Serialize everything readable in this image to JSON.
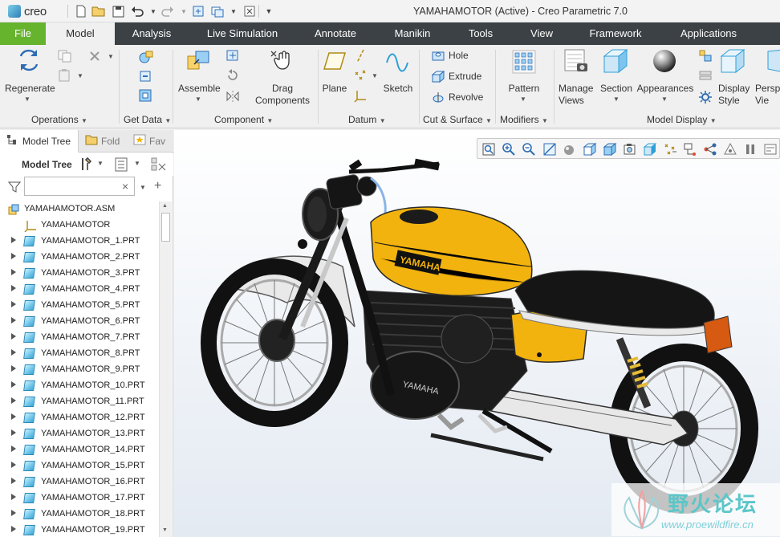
{
  "app": {
    "logo_text": "creo",
    "window_title": "YAMAHAMOTOR (Active) - Creo Parametric 7.0"
  },
  "tabs": [
    {
      "label": "File"
    },
    {
      "label": "Model"
    },
    {
      "label": "Analysis"
    },
    {
      "label": "Live Simulation"
    },
    {
      "label": "Annotate"
    },
    {
      "label": "Manikin"
    },
    {
      "label": "Tools"
    },
    {
      "label": "View"
    },
    {
      "label": "Framework"
    },
    {
      "label": "Applications"
    }
  ],
  "ribbon": {
    "regenerate": "Regenerate",
    "assemble": "Assemble",
    "drag_components": "Drag\nComponents",
    "plane": "Plane",
    "sketch": "Sketch",
    "hole": "Hole",
    "extrude": "Extrude",
    "revolve": "Revolve",
    "pattern": "Pattern",
    "manage_views": "Manage\nViews",
    "section": "Section",
    "appearances": "Appearances",
    "display_style": "Display\nStyle",
    "perspective": "Perspe\nVie",
    "groups": {
      "operations": "Operations",
      "get_data": "Get Data",
      "component": "Component",
      "datum": "Datum",
      "cut_surface": "Cut & Surface",
      "modifiers": "Modifiers",
      "model_display": "Model Display"
    }
  },
  "left_panel": {
    "tabs": [
      "Model Tree",
      "Fold",
      "Fav"
    ],
    "toolbar_label": "Model Tree",
    "search_value": "",
    "root": "YAMAHAMOTOR.ASM",
    "csys": "YAMAHAMOTOR",
    "parts": [
      "YAMAHAMOTOR_1.PRT",
      "YAMAHAMOTOR_2.PRT",
      "YAMAHAMOTOR_3.PRT",
      "YAMAHAMOTOR_4.PRT",
      "YAMAHAMOTOR_5.PRT",
      "YAMAHAMOTOR_6.PRT",
      "YAMAHAMOTOR_7.PRT",
      "YAMAHAMOTOR_8.PRT",
      "YAMAHAMOTOR_9.PRT",
      "YAMAHAMOTOR_10.PRT",
      "YAMAHAMOTOR_11.PRT",
      "YAMAHAMOTOR_12.PRT",
      "YAMAHAMOTOR_13.PRT",
      "YAMAHAMOTOR_14.PRT",
      "YAMAHAMOTOR_15.PRT",
      "YAMAHAMOTOR_16.PRT",
      "YAMAHAMOTOR_17.PRT",
      "YAMAHAMOTOR_18.PRT",
      "YAMAHAMOTOR_19.PRT"
    ]
  },
  "model": {
    "tank_brand": "YAMAHA",
    "engine_brand": "YAMAHA"
  },
  "watermark": {
    "cn": "野火论坛",
    "url": "www.proewildfire.cn"
  },
  "colors": {
    "file_tab": "#66b32e",
    "tab_bar": "#3c4145",
    "tank": "#f2b30f"
  }
}
